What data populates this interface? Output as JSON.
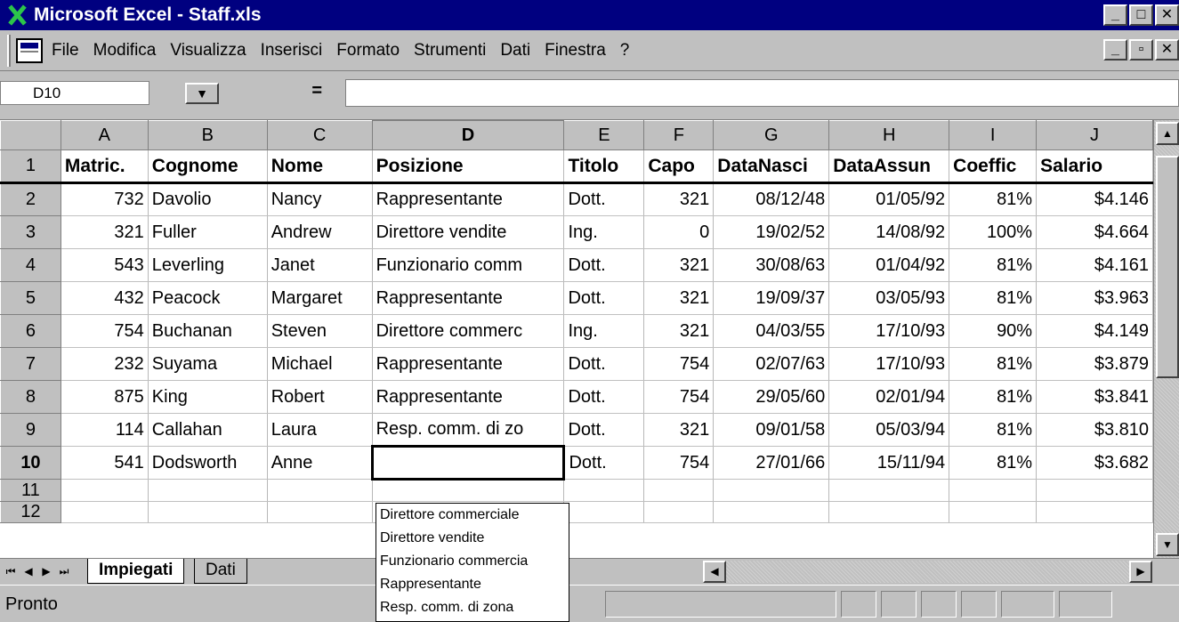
{
  "window": {
    "title": "Microsoft Excel - Staff.xls"
  },
  "menu": {
    "items": [
      "File",
      "Modifica",
      "Visualizza",
      "Inserisci",
      "Formato",
      "Strumenti",
      "Dati",
      "Finestra",
      "?"
    ]
  },
  "formula_bar": {
    "name_box": "D10",
    "equals": "=",
    "value": ""
  },
  "columns": [
    "A",
    "B",
    "C",
    "D",
    "E",
    "F",
    "G",
    "H",
    "I",
    "J"
  ],
  "active_column": "D",
  "rows": [
    {
      "n": "1",
      "cells": [
        "Matric.",
        "Cognome",
        "Nome",
        "Posizione",
        "Titolo",
        "Capo",
        "DataNasci",
        "DataAssun",
        "Coeffic",
        "Salario"
      ]
    },
    {
      "n": "2",
      "cells": [
        "732",
        "Davolio",
        "Nancy",
        "Rappresentante",
        "Dott.",
        "321",
        "08/12/48",
        "01/05/92",
        "81%",
        "$4.146"
      ]
    },
    {
      "n": "3",
      "cells": [
        "321",
        "Fuller",
        "Andrew",
        "Direttore vendite",
        "Ing.",
        "0",
        "19/02/52",
        "14/08/92",
        "100%",
        "$4.664"
      ]
    },
    {
      "n": "4",
      "cells": [
        "543",
        "Leverling",
        "Janet",
        "Funzionario comm",
        "Dott.",
        "321",
        "30/08/63",
        "01/04/92",
        "81%",
        "$4.161"
      ]
    },
    {
      "n": "5",
      "cells": [
        "432",
        "Peacock",
        "Margaret",
        "Rappresentante",
        "Dott.",
        "321",
        "19/09/37",
        "03/05/93",
        "81%",
        "$3.963"
      ]
    },
    {
      "n": "6",
      "cells": [
        "754",
        "Buchanan",
        "Steven",
        "Direttore commerc",
        "Ing.",
        "321",
        "04/03/55",
        "17/10/93",
        "90%",
        "$4.149"
      ]
    },
    {
      "n": "7",
      "cells": [
        "232",
        "Suyama",
        "Michael",
        "Rappresentante",
        "Dott.",
        "754",
        "02/07/63",
        "17/10/93",
        "81%",
        "$3.879"
      ]
    },
    {
      "n": "8",
      "cells": [
        "875",
        "King",
        "Robert",
        "Rappresentante",
        "Dott.",
        "754",
        "29/05/60",
        "02/01/94",
        "81%",
        "$3.841"
      ]
    },
    {
      "n": "9",
      "cells": [
        "114",
        "Callahan",
        "Laura",
        "Resp. comm. di zo",
        "Dott.",
        "321",
        "09/01/58",
        "05/03/94",
        "81%",
        "$3.810"
      ]
    },
    {
      "n": "10",
      "cells": [
        "541",
        "Dodsworth",
        "Anne",
        "",
        "Dott.",
        "754",
        "27/01/66",
        "15/11/94",
        "81%",
        "$3.682"
      ]
    },
    {
      "n": "11",
      "cells": [
        "",
        "",
        "",
        "",
        "",
        "",
        "",
        "",
        "",
        ""
      ]
    },
    {
      "n": "12",
      "cells": [
        "",
        "",
        "",
        "",
        "",
        "",
        "",
        "",
        "",
        ""
      ]
    }
  ],
  "active_row": "10",
  "dropdown": {
    "options": [
      "Direttore commerciale",
      "Direttore vendite",
      "Funzionario commercia",
      "Rappresentante",
      "Resp. comm. di zona"
    ]
  },
  "sheet_tabs": [
    "Impiegati",
    "Dati"
  ],
  "active_sheet": "Impiegati",
  "status": {
    "text": "Pronto"
  },
  "colors": {
    "title_bar": "#000080",
    "face": "#c0c0c0"
  }
}
